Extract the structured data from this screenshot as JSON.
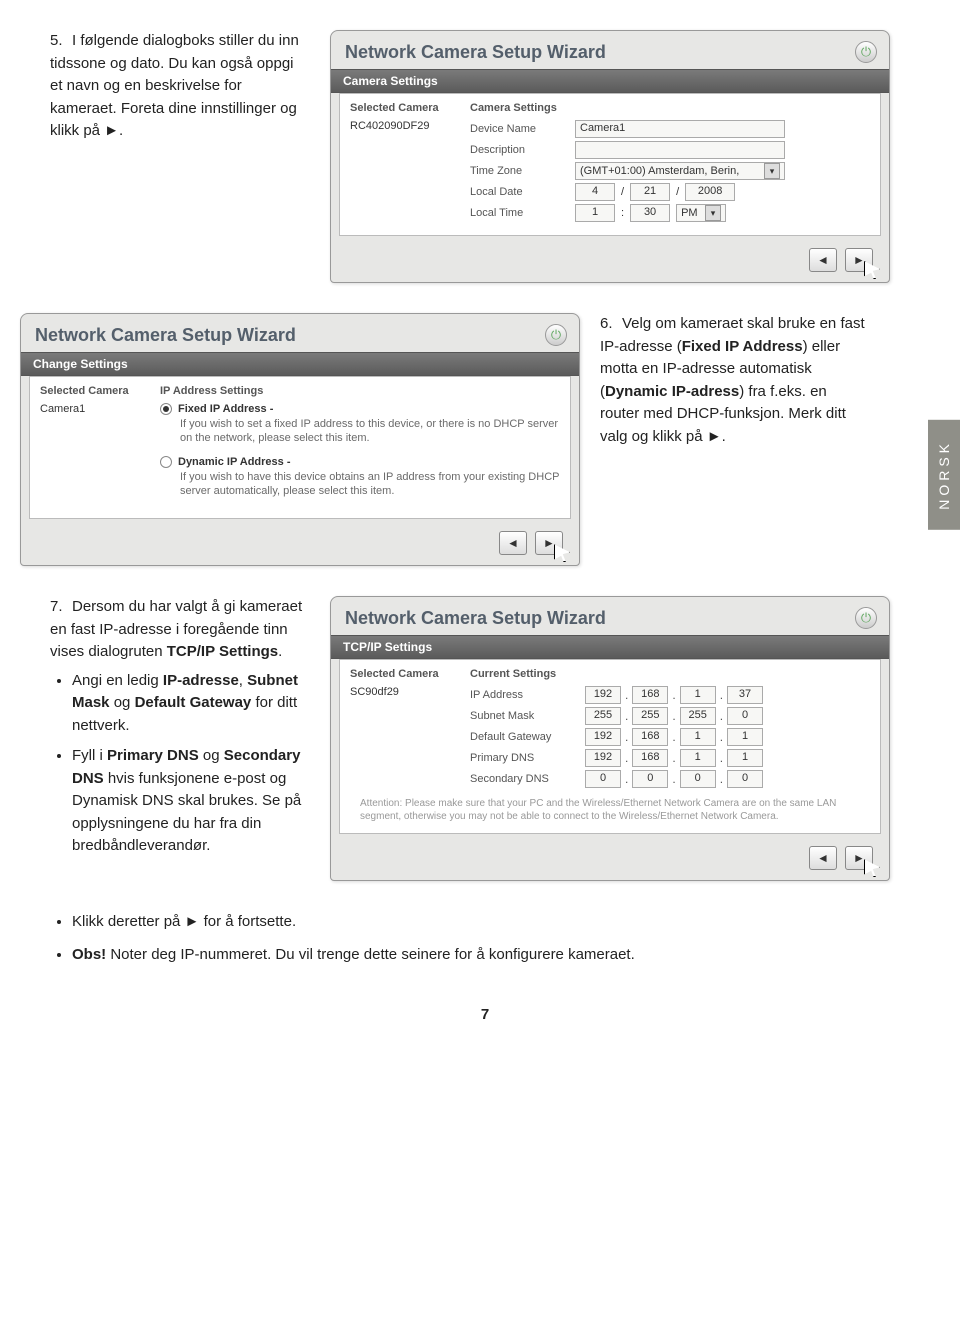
{
  "side_tab": "NORSK",
  "page_number": "7",
  "step5": {
    "num": "5.",
    "text": "I følgende dialogboks stiller du inn tidssone og dato. Du kan også oppgi et navn og en beskrivelse for kameraet. Foreta dine innstillinger og klikk på ►."
  },
  "step6": {
    "num": "6.",
    "text_a": "Velg om kameraet skal bruke en fast IP-adresse (",
    "bold_a": "Fixed IP Address",
    "text_b": ") eller motta en IP-adresse automatisk (",
    "bold_b": "Dynamic IP-adress",
    "text_c": ") fra f.eks. en router med DHCP-funksjon. Merk ditt valg og klikk på ►."
  },
  "step7": {
    "num": "7.",
    "text_a": "Dersom du har valgt å gi kameraet en fast IP-adresse i foregående tinn vises dialogruten ",
    "bold_a": "TCP/IP Settings",
    "text_b": ".",
    "bullets": [
      {
        "pre": "Angi en ledig ",
        "b1": "IP-adresse",
        "mid1": ", ",
        "b2": "Subnet Mask",
        "mid2": " og ",
        "b3": "Default Gateway",
        "post": " for ditt nettverk."
      },
      {
        "pre": "Fyll i ",
        "b1": "Primary DNS",
        "mid1": " og ",
        "b2": "Secondary DNS",
        "mid2": "",
        "b3": "",
        "post": " hvis funksjonene e-post og Dynamisk DNS skal brukes. Se på opplysningene du har fra din bredbåndleverandør."
      }
    ]
  },
  "bottom": [
    "Klikk deretter på ► for å fortsette.",
    "Obs! Noter deg IP-nummeret. Du vil trenge dette seinere for å konfigurere kameraet."
  ],
  "wizard_title": "Network Camera Setup Wizard",
  "w1": {
    "section": "Camera Settings",
    "sel_head": "Selected Camera",
    "set_head": "Camera Settings",
    "selected": "RC402090DF29",
    "fields": {
      "device_name_l": "Device Name",
      "device_name_v": "Camera1",
      "description_l": "Description",
      "description_v": "",
      "timezone_l": "Time Zone",
      "timezone_v": "(GMT+01:00) Amsterdam, Berin,",
      "localdate_l": "Local Date",
      "d_m": "4",
      "d_d": "21",
      "d_y": "2008",
      "localtime_l": "Local Time",
      "t_h": "1",
      "t_m": "30",
      "ampm": "PM"
    }
  },
  "w2": {
    "section": "Change Settings",
    "sel_head": "Selected Camera",
    "set_head": "IP Address Settings",
    "selected": "Camera1",
    "opt1_h": "Fixed IP Address -",
    "opt1_d": "If you wish to set a fixed IP address to this device, or there is no DHCP server on the network, please select this item.",
    "opt2_h": "Dynamic IP Address -",
    "opt2_d": "If you wish to have this device obtains an IP address from your existing DHCP server automatically, please select this item."
  },
  "w3": {
    "section": "TCP/IP Settings",
    "sel_head": "Selected Camera",
    "set_head": "Current Settings",
    "selected": "SC90df29",
    "labels": {
      "ip": "IP Address",
      "mask": "Subnet Mask",
      "gw": "Default Gateway",
      "dns1": "Primary DNS",
      "dns2": "Secondary DNS"
    },
    "vals": {
      "ip": [
        "192",
        "168",
        "1",
        "37"
      ],
      "mask": [
        "255",
        "255",
        "255",
        "0"
      ],
      "gw": [
        "192",
        "168",
        "1",
        "1"
      ],
      "dns1": [
        "192",
        "168",
        "1",
        "1"
      ],
      "dns2": [
        "0",
        "0",
        "0",
        "0"
      ]
    },
    "attention": "Attention: Please make sure that your PC and the Wireless/Ethernet Network Camera are on the same LAN segment, otherwise you may not be able to connect to the Wireless/Ethernet Network Camera."
  }
}
